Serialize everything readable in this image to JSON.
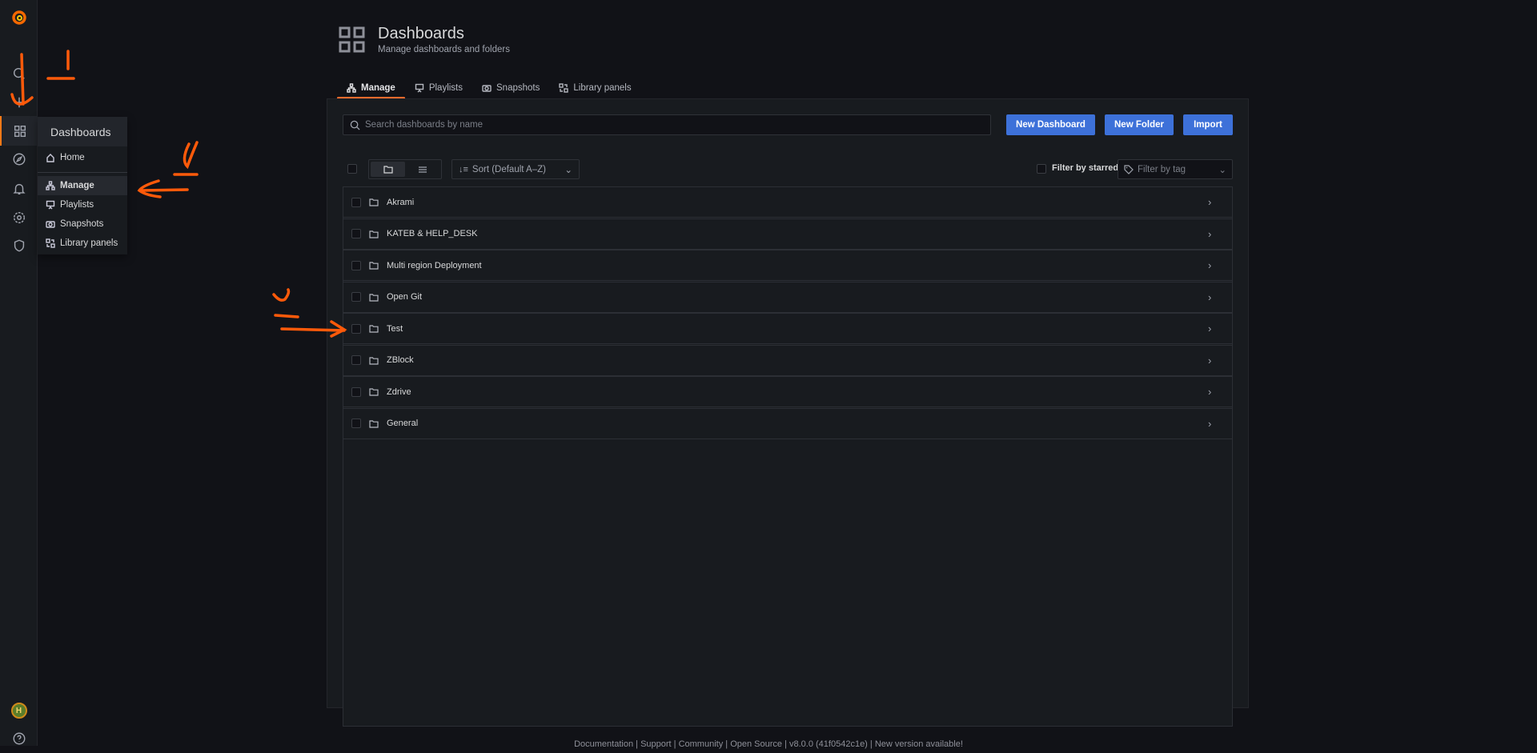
{
  "sidebar": {
    "items": [
      {
        "icon": "grafana-logo-icon"
      },
      {
        "icon": "search-icon"
      },
      {
        "icon": "plus-icon"
      },
      {
        "icon": "dashboards-icon",
        "active": true
      },
      {
        "icon": "explore-icon"
      },
      {
        "icon": "alerting-bell-icon"
      },
      {
        "icon": "configuration-gear-icon"
      },
      {
        "icon": "server-admin-shield-icon"
      }
    ],
    "bottom": [
      {
        "icon": "user-avatar-icon"
      },
      {
        "icon": "help-icon"
      }
    ]
  },
  "flyout": {
    "title": "Dashboards",
    "items": [
      {
        "label": "Home"
      },
      {
        "label": "Manage",
        "active": true
      },
      {
        "label": "Playlists"
      },
      {
        "label": "Snapshots"
      },
      {
        "label": "Library panels"
      }
    ]
  },
  "header": {
    "title": "Dashboards",
    "subtitle": "Manage dashboards and folders"
  },
  "tabs": [
    {
      "label": "Manage",
      "active": true
    },
    {
      "label": "Playlists"
    },
    {
      "label": "Snapshots"
    },
    {
      "label": "Library panels"
    }
  ],
  "search": {
    "placeholder": "Search dashboards by name",
    "value": ""
  },
  "buttons": {
    "new_dashboard": "New Dashboard",
    "new_folder": "New Folder",
    "import": "Import"
  },
  "toolbar": {
    "sort": "Sort (Default A–Z)",
    "filter_starred": "Filter by starred",
    "filter_tag_placeholder": "Filter by tag"
  },
  "folders": [
    {
      "name": "Akrami"
    },
    {
      "name": "KATEB & HELP_DESK"
    },
    {
      "name": "Multi region Deployment"
    },
    {
      "name": "Open Git"
    },
    {
      "name": "Test"
    },
    {
      "name": "ZBlock"
    },
    {
      "name": "Zdrive"
    },
    {
      "name": "General"
    }
  ],
  "footer": {
    "documentation": "Documentation",
    "support": "Support",
    "community": "Community",
    "open_source": "Open Source",
    "version": "v8.0.0 (41f0542c1e)",
    "new_version": "New version available!"
  },
  "colors": {
    "accent": "#ff7a17",
    "primary_button": "#3d71d9",
    "annotation": "#ff5a0a"
  }
}
